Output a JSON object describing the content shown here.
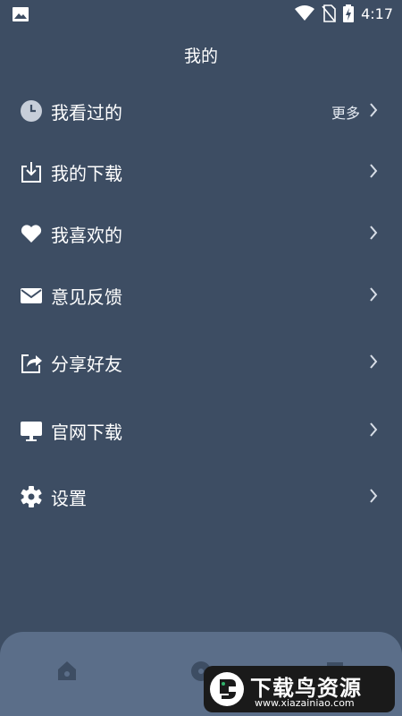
{
  "status_bar": {
    "time": "4:17"
  },
  "header": {
    "title": "我的"
  },
  "menu": [
    {
      "label": "我看过的",
      "more": "更多",
      "icon": "clock-icon"
    },
    {
      "label": "我的下载",
      "icon": "download-icon"
    },
    {
      "label": "我喜欢的",
      "icon": "heart-icon"
    },
    {
      "label": "意见反馈",
      "icon": "mail-icon"
    },
    {
      "label": "分享好友",
      "icon": "share-icon"
    },
    {
      "label": "官网下载",
      "icon": "monitor-icon"
    },
    {
      "label": "设置",
      "icon": "gear-icon"
    }
  ],
  "bottom_nav": {
    "tabs": [
      "home-icon",
      "discover-icon",
      "profile-icon"
    ]
  },
  "watermark": {
    "brand": "下载鸟资源",
    "url": "www.xiazainiao.com"
  },
  "colors": {
    "background": "#3d4d63",
    "bottom_nav": "#5b6e89"
  }
}
